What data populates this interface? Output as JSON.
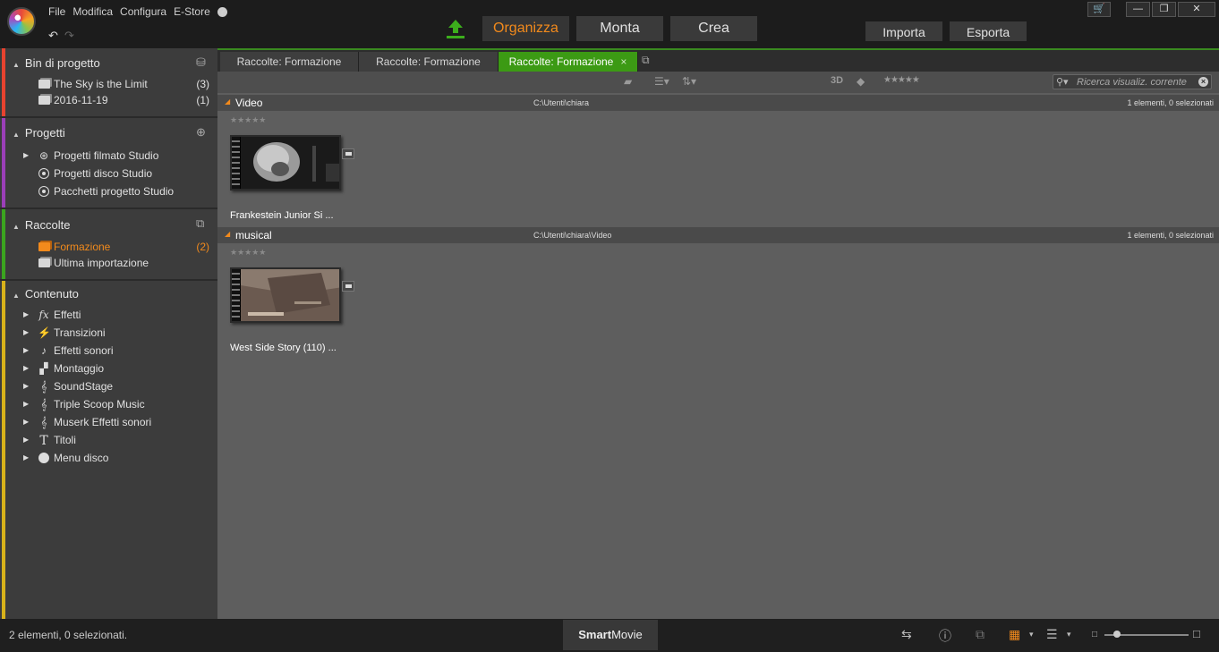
{
  "menu": {
    "file": "File",
    "edit": "Modifica",
    "config": "Configura",
    "estore": "E-Store",
    "help": "?"
  },
  "modes": {
    "organize": "Organizza",
    "edit": "Monta",
    "create": "Crea"
  },
  "io": {
    "import": "Importa",
    "export": "Esporta"
  },
  "window": {
    "cart": "🛒",
    "minimize": "—",
    "restore": "❐",
    "close": "✕"
  },
  "sidebar": {
    "bin": {
      "title": "Bin di progetto",
      "items": [
        {
          "label": "The Sky is the Limit",
          "count": "(3)"
        },
        {
          "label": "2016-11-19",
          "count": "(1)"
        }
      ]
    },
    "projects": {
      "title": "Progetti",
      "items": [
        {
          "label": "Progetti filmato Studio"
        },
        {
          "label": "Progetti disco Studio"
        },
        {
          "label": "Pacchetti progetto Studio"
        }
      ]
    },
    "collections": {
      "title": "Raccolte",
      "items": [
        {
          "label": "Formazione",
          "count": "(2)"
        },
        {
          "label": "Ultima importazione"
        }
      ]
    },
    "content": {
      "title": "Contenuto",
      "items": [
        {
          "label": "Effetti",
          "icon": "fx"
        },
        {
          "label": "Transizioni",
          "icon": "⚡"
        },
        {
          "label": "Effetti sonori",
          "icon": "♪"
        },
        {
          "label": "Montaggio",
          "icon": "▞"
        },
        {
          "label": "SoundStage",
          "icon": "𝄞"
        },
        {
          "label": "Triple Scoop Music",
          "icon": "𝄞"
        },
        {
          "label": "Muserk Effetti sonori",
          "icon": "𝄞"
        },
        {
          "label": "Titoli",
          "icon": "T"
        },
        {
          "label": "Menu disco",
          "icon": ""
        }
      ]
    }
  },
  "tabs": [
    {
      "label": "Raccolte: Formazione"
    },
    {
      "label": "Raccolte: Formazione"
    },
    {
      "label": "Raccolte: Formazione",
      "close": "×"
    }
  ],
  "toolbar": {
    "label_3d": "3D",
    "stars": "★★★★★",
    "search_placeholder": "Ricerca visualiz. corrente"
  },
  "groups": [
    {
      "name": "Video",
      "path": "C:\\Utenti\\chiara",
      "status": "1 elementi, 0 selezionati",
      "stars": "★★★★★",
      "clip": "Frankestein Junior  Si ..."
    },
    {
      "name": "musical",
      "path": "C:\\Utenti\\chiara\\Video",
      "status": "1 elementi, 0 selezionati",
      "stars": "★★★★★",
      "clip": "West Side Story (110) ..."
    }
  ],
  "status": {
    "text": "2 elementi, 0 selezionati.",
    "smart_bold": "Smart",
    "smart_rest": "Movie"
  },
  "colors": {
    "accent": "#f28a1c",
    "active_tab": "#3c9a14",
    "bin_bar": "#e8432f",
    "projects_bar": "#9b3fb8",
    "collections_bar": "#3ba51f",
    "content_bar": "#d8b21a"
  }
}
